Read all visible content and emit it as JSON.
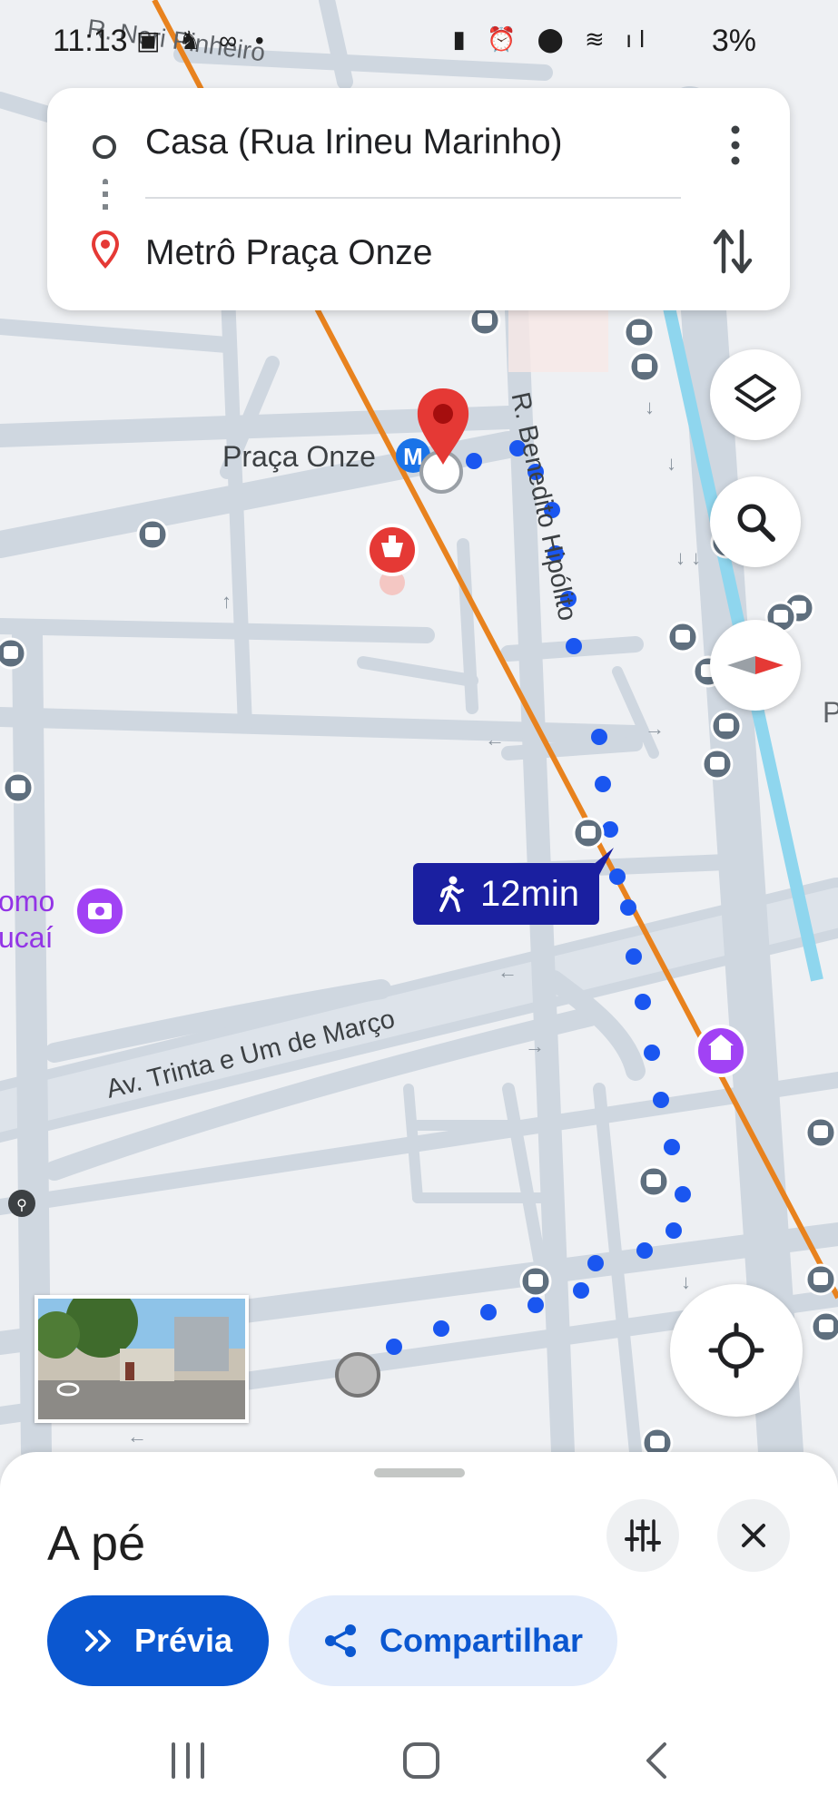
{
  "status_bar": {
    "time": "11:13",
    "battery": "3%"
  },
  "route": {
    "origin": "Casa (Rua Irineu Marinho)",
    "destination": "Metrô Praça Onze"
  },
  "map": {
    "labels": {
      "station": "Praça Onze",
      "street_top": "R. Neri Pinheiro",
      "street_vertical": "R. Benedito Hipólito",
      "avenue": "Av. Trinta e Um de Março",
      "poi_line1": "omo",
      "poi_line2": "ucaí",
      "edge_letter": "P"
    },
    "eta": "12min"
  },
  "sheet": {
    "mode_title": "A pé",
    "preview_label": "Prévia",
    "share_label": "Compartilhar"
  },
  "colors": {
    "route_dots": "#1a56f0",
    "metro_line": "#e8821e",
    "eta_bg": "#1a1fa0",
    "primary": "#0b57d0",
    "pin_red": "#e53935",
    "poi_purple": "#a142f4",
    "road": "#c9d3de",
    "water": "#8fd6ee"
  }
}
